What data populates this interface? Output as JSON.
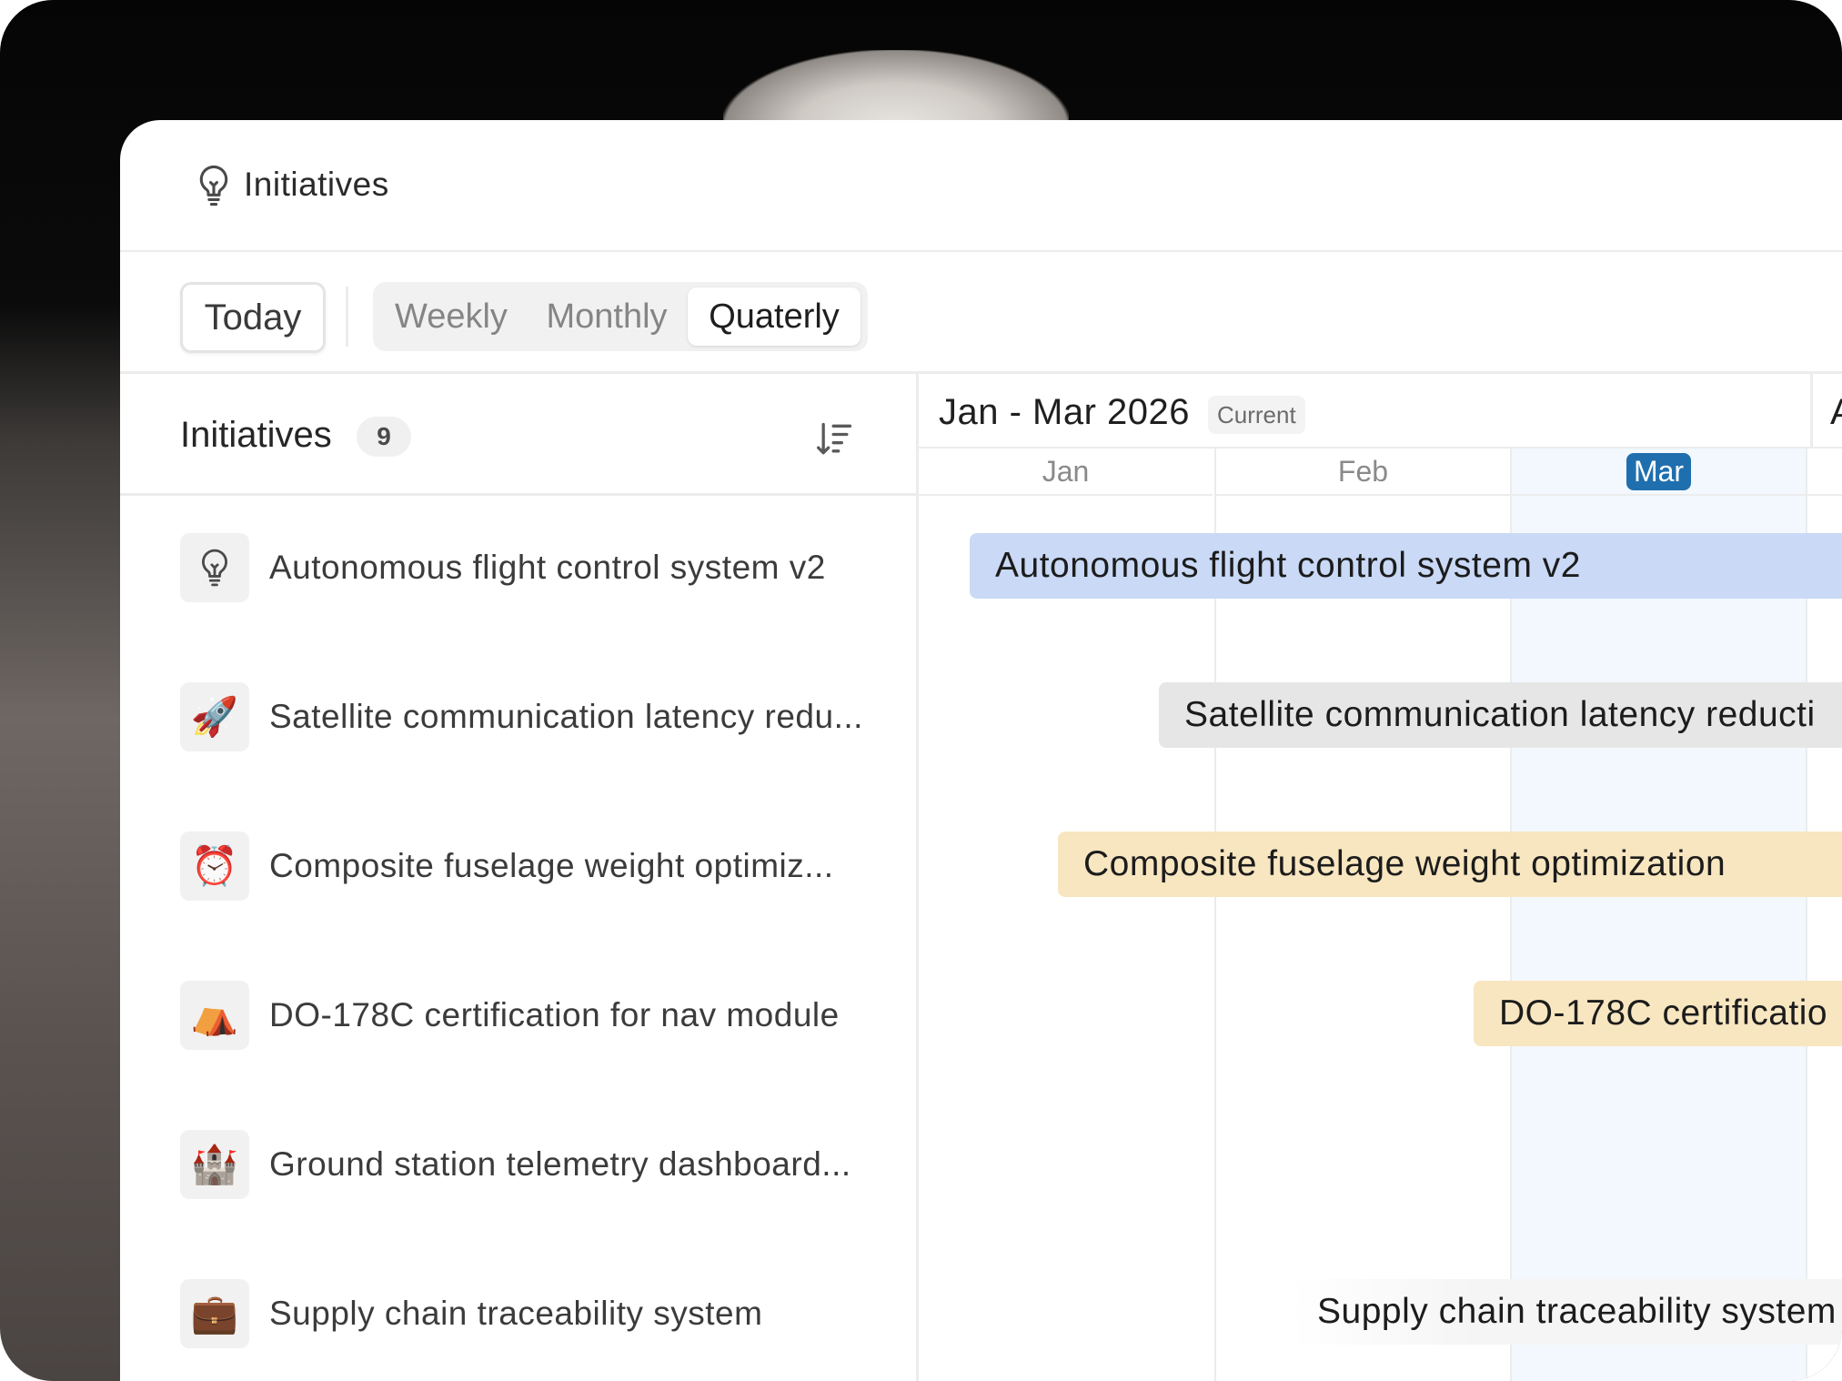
{
  "header": {
    "title": "Initiatives",
    "icon": "lightbulb-icon"
  },
  "toolbar": {
    "today_label": "Today",
    "views": [
      {
        "label": "Weekly",
        "selected": false
      },
      {
        "label": "Monthly",
        "selected": false
      },
      {
        "label": "Quaterly",
        "selected": true
      }
    ]
  },
  "list": {
    "title": "Initiatives",
    "count": "9",
    "sort_icon": "sort-descending-icon",
    "items": [
      {
        "label": "Autonomous flight control system v2",
        "icon": "lightbulb-icon",
        "glyph": ""
      },
      {
        "label": "Satellite communication latency redu...",
        "icon": "rocket-icon",
        "glyph": "🚀"
      },
      {
        "label": "Composite fuselage weight optimiz...",
        "icon": "alarm-clock-icon",
        "glyph": "⏰"
      },
      {
        "label": "DO-178C certification for nav module",
        "icon": "tent-icon",
        "glyph": "⛺"
      },
      {
        "label": "Ground station telemetry dashboard...",
        "icon": "castle-icon",
        "glyph": "🏰"
      },
      {
        "label": "Supply chain traceability system",
        "icon": "briefcase-icon",
        "glyph": "💼"
      }
    ]
  },
  "timeline": {
    "period": "Jan - Mar 2026",
    "current_badge": "Current",
    "next_period_initial": "A",
    "months": [
      {
        "label": "Jan",
        "current": false
      },
      {
        "label": "Feb",
        "current": false
      },
      {
        "label": "Mar",
        "current": true
      }
    ],
    "bars": [
      {
        "label": "Autonomous flight control system v2",
        "color": "#c9d9f6"
      },
      {
        "label": "Satellite communication latency reducti",
        "color": "#e6e6e6"
      },
      {
        "label": "Composite fuselage weight optimization",
        "color": "#f8e6c0"
      },
      {
        "label": "DO-178C certificatio",
        "color": "#f8e6c0"
      },
      {
        "label": "",
        "color": "#ffffff"
      },
      {
        "label": "Supply chain traceability system",
        "color": "#f5f5f5"
      }
    ]
  },
  "colors": {
    "accent": "#1f6fae",
    "current_month_bg": "#f2f8fd"
  }
}
